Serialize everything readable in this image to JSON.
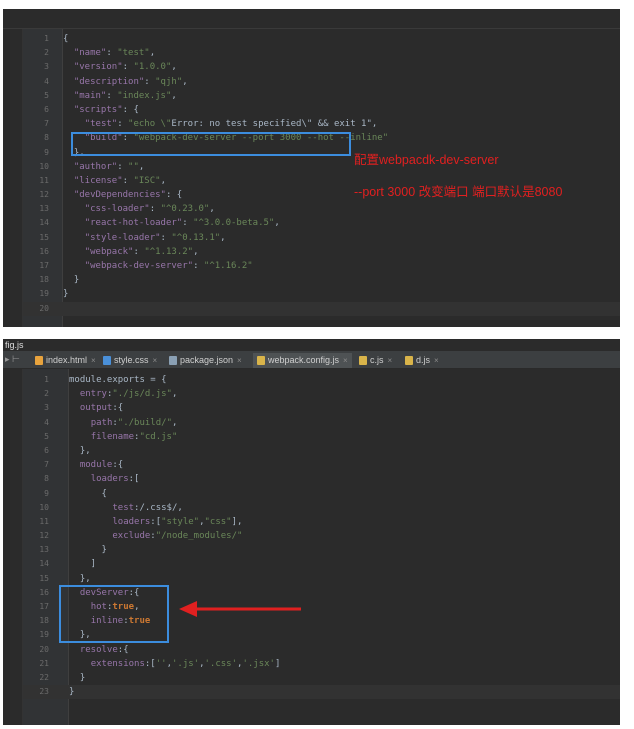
{
  "panel1": {
    "lines": [
      {
        "n": "1",
        "text": "{"
      },
      {
        "n": "2",
        "text": "  \"name\": \"test\","
      },
      {
        "n": "3",
        "text": "  \"version\": \"1.0.0\","
      },
      {
        "n": "4",
        "text": "  \"description\": \"qjh\","
      },
      {
        "n": "5",
        "text": "  \"main\": \"index.js\","
      },
      {
        "n": "6",
        "text": "  \"scripts\": {"
      },
      {
        "n": "7",
        "text": "    \"test\": \"echo \\\"Error: no test specified\\\" && exit 1\","
      },
      {
        "n": "8",
        "text": "    \"build\": \"webpack-dev-server --port 3000 --hot --inline\""
      },
      {
        "n": "9",
        "text": "  },"
      },
      {
        "n": "10",
        "text": "  \"author\": \"\","
      },
      {
        "n": "11",
        "text": "  \"license\": \"ISC\","
      },
      {
        "n": "12",
        "text": "  \"devDependencies\": {"
      },
      {
        "n": "13",
        "text": "    \"css-loader\": \"^0.23.0\","
      },
      {
        "n": "14",
        "text": "    \"react-hot-loader\": \"^3.0.0-beta.5\","
      },
      {
        "n": "15",
        "text": "    \"style-loader\": \"^0.13.1\","
      },
      {
        "n": "16",
        "text": "    \"webpack\": \"^1.13.2\","
      },
      {
        "n": "17",
        "text": "    \"webpack-dev-server\": \"^1.16.2\""
      },
      {
        "n": "18",
        "text": "  }"
      },
      {
        "n": "19",
        "text": "}"
      },
      {
        "n": "20",
        "text": ""
      }
    ],
    "annotation_line1": "配置webpacdk-dev-server",
    "annotation_line2": "--port 3000 改变端口 端口默认是8080"
  },
  "panel2": {
    "file_path": "fig.js",
    "tabs": [
      {
        "label": "index.html",
        "icon_color": "#e8a33d",
        "active": false
      },
      {
        "label": "style.css",
        "icon_color": "#4a90d9",
        "active": false
      },
      {
        "label": "package.json",
        "icon_color": "#8aa0b4",
        "active": false
      },
      {
        "label": "webpack.config.js",
        "icon_color": "#d9b44a",
        "active": true
      },
      {
        "label": "c.js",
        "icon_color": "#d9b44a",
        "active": false
      },
      {
        "label": "d.js",
        "icon_color": "#d9b44a",
        "active": false
      }
    ],
    "close_glyph": "×",
    "lines": [
      {
        "n": "1",
        "text": "module.exports = {"
      },
      {
        "n": "2",
        "text": "  entry:\"./js/d.js\","
      },
      {
        "n": "3",
        "text": "  output:{"
      },
      {
        "n": "4",
        "text": "    path:\"./build/\","
      },
      {
        "n": "5",
        "text": "    filename:\"cd.js\""
      },
      {
        "n": "6",
        "text": "  },"
      },
      {
        "n": "7",
        "text": "  module:{"
      },
      {
        "n": "8",
        "text": "    loaders:["
      },
      {
        "n": "9",
        "text": "      {"
      },
      {
        "n": "10",
        "text": "        test:/.css$/,"
      },
      {
        "n": "11",
        "text": "        loaders:[\"style\",\"css\"],"
      },
      {
        "n": "12",
        "text": "        exclude:\"/node_modules/\""
      },
      {
        "n": "13",
        "text": "      }"
      },
      {
        "n": "14",
        "text": "    ]"
      },
      {
        "n": "15",
        "text": "  },"
      },
      {
        "n": "16",
        "text": "  devServer:{"
      },
      {
        "n": "17",
        "text": "    hot:true,"
      },
      {
        "n": "18",
        "text": "    inline:true"
      },
      {
        "n": "19",
        "text": "  },"
      },
      {
        "n": "20",
        "text": "  resolve:{"
      },
      {
        "n": "21",
        "text": "    extensions:['','.js','.css','.jsx']"
      },
      {
        "n": "22",
        "text": "  }"
      },
      {
        "n": "23",
        "text": "}"
      }
    ]
  },
  "colors": {
    "editor_bg": "#2b2b2b",
    "gutter_bg": "#313335",
    "string": "#6a8759",
    "property": "#9876aa",
    "keyword": "#cc7832",
    "highlight_box": "#3c8dde",
    "annotation": "#e02020"
  }
}
